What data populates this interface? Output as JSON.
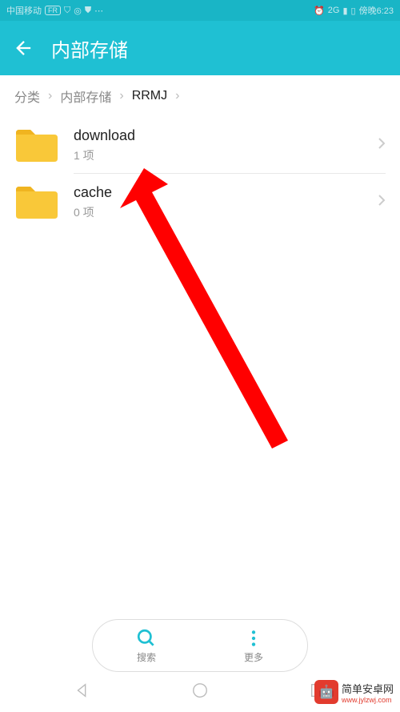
{
  "status": {
    "carrier": "中国移动",
    "signal_type": "2G",
    "time": "傍晚6:23"
  },
  "header": {
    "title": "内部存储"
  },
  "breadcrumb": {
    "items": [
      "分类",
      "内部存储",
      "RRMJ"
    ]
  },
  "folders": [
    {
      "name": "download",
      "count": "1 项"
    },
    {
      "name": "cache",
      "count": "0 项"
    }
  ],
  "bottom": {
    "search": "搜索",
    "more": "更多"
  },
  "watermark": {
    "title": "简单安卓网",
    "url": "www.jylzwj.com"
  }
}
